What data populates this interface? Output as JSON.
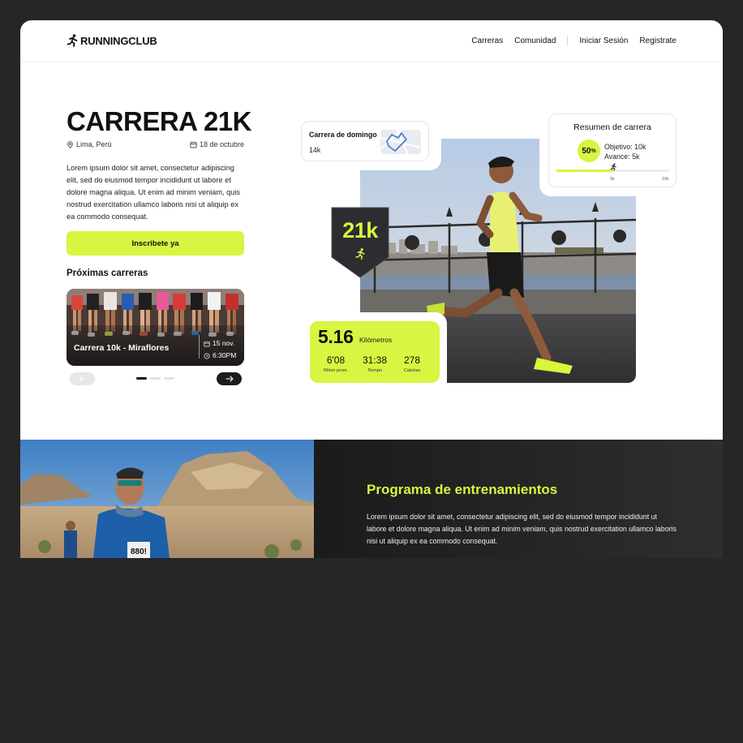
{
  "header": {
    "brand": "RUNNINGCLUB",
    "nav": [
      "Carreras",
      "Comunidad",
      "Iniciar Sesión",
      "Registrate"
    ]
  },
  "hero": {
    "title": "CARRERA 21K",
    "location": "Lima, Perú",
    "date": "18 de octubre",
    "description": "Lorem ipsum dolor sit amet, consectetur adipiscing elit, sed do eiusmod tempor incididunt ut labore et dolore magna aliqua. Ut enim ad minim veniam, quis nostrud exercitation ullamco laboris nisi ut aliquip ex ea commodo consequat.",
    "cta": "Inscribete ya",
    "upcoming_title": "Próximas carreras",
    "upcoming": {
      "name": "Carrera 10k - Miraflores",
      "date": "15 nov.",
      "time": "6:30PM"
    },
    "carousel": {
      "active_index": 0,
      "count": 3
    }
  },
  "collage": {
    "sunday_card": {
      "title": "Carrera de domingo",
      "value": "14k"
    },
    "summary": {
      "title": "Resumen de carrera",
      "percent": "50",
      "percent_sign": "%",
      "goal": "Objetivo: 10k",
      "progress": "Avance: 5k",
      "progress_fraction": 0.5,
      "tick_mid": "5k",
      "tick_end": "10k"
    },
    "badge": "21k",
    "stats": {
      "distance": "5.16",
      "distance_label": "Kilómetros",
      "items": [
        {
          "value": "6'08",
          "label": "Ritmo prom."
        },
        {
          "value": "31:38",
          "label": "Tiempo"
        },
        {
          "value": "278",
          "label": "Calorías"
        }
      ]
    }
  },
  "program": {
    "title": "Programa de entrenamientos",
    "text": "Lorem ipsum dolor sit amet, consectetur adipiscing elit, sed do eiusmod tempor incididunt ut labore et dolore magna aliqua. Ut enim ad minim veniam, quis nostrud exercitation ullamco laboris nisi ut aliquip ex ea commodo consequat."
  },
  "colors": {
    "accent": "#d6f641",
    "dark": "#262626"
  }
}
